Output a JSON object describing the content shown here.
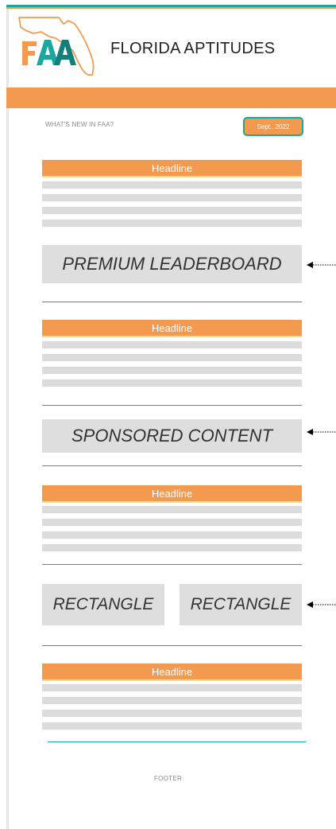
{
  "header": {
    "logo_text": "FAA",
    "title": "FLORIDA APTITUDES"
  },
  "intro": {
    "whats_new": "WHAT'S NEW IN FAA?",
    "date_badge": "Sept., 2022"
  },
  "sections": [
    {
      "headline": "Headline"
    },
    {
      "headline": "Headline"
    },
    {
      "headline": "Headline"
    },
    {
      "headline": "Headline"
    }
  ],
  "ads": {
    "premium_leaderboard": "PREMIUM LEADERBOARD",
    "sponsored_content": "SPONSORED CONTENT",
    "rectangle_left": "RECTANGLE",
    "rectangle_right": "RECTANGLE"
  },
  "footer": {
    "label": "FOOTER"
  },
  "colors": {
    "orange": "#f39a4f",
    "teal": "#1aa7a0",
    "placeholder_gray": "#dcdcdc"
  }
}
